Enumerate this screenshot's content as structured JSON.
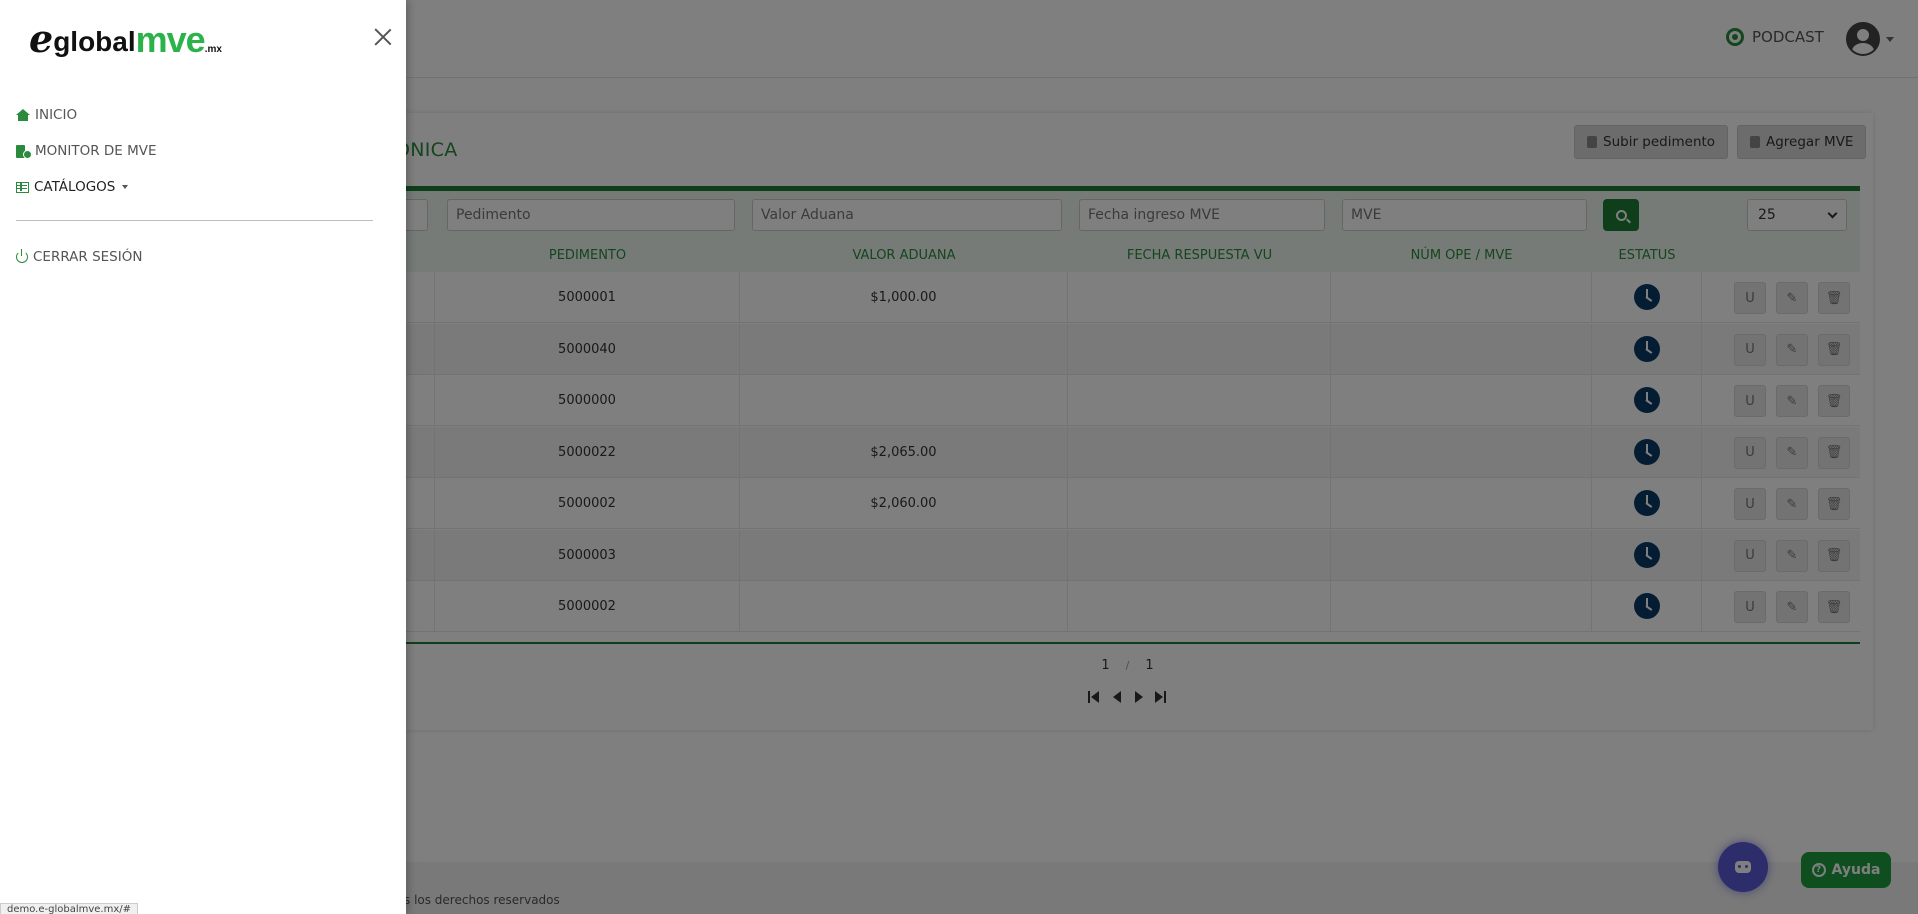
{
  "header": {
    "podcast_label": "PODCAST"
  },
  "card": {
    "title_fragment": "ÓNICA",
    "upload_button": "Subir pedimento",
    "add_button": "Agregar MVE"
  },
  "filters": {
    "pedimento_placeholder": "Pedimento",
    "valor_aduana_placeholder": "Valor Aduana",
    "fecha_ingreso_placeholder": "Fecha ingreso MVE",
    "mve_placeholder": "MVE",
    "page_size": "25"
  },
  "table": {
    "headers": {
      "pedimento": "PEDIMENTO",
      "valor_aduana": "VALOR ADUANA",
      "fecha_respuesta": "FECHA RESPUESTA VU",
      "num_ope": "NÚM OPE / MVE",
      "estatus": "ESTATUS"
    },
    "rows": [
      {
        "pedimento": "5000001",
        "valor_aduana": "$1,000.00"
      },
      {
        "pedimento": "5000040",
        "valor_aduana": ""
      },
      {
        "pedimento": "5000000",
        "valor_aduana": ""
      },
      {
        "pedimento": "5000022",
        "valor_aduana": "$2,065.00"
      },
      {
        "pedimento": "5000002",
        "valor_aduana": "$2,060.00"
      },
      {
        "pedimento": "5000003",
        "valor_aduana": ""
      },
      {
        "pedimento": "5000002",
        "valor_aduana": ""
      }
    ],
    "action_u_label": "U"
  },
  "pager": {
    "current": "1",
    "separator": "/",
    "total": "1"
  },
  "footer": {
    "text": "s los derechos reservados"
  },
  "help": {
    "label": "Ayuda"
  },
  "drawer": {
    "logo": {
      "e": "e",
      "global": "global",
      "mve": "mve",
      "mx": ".mx"
    },
    "items": [
      {
        "label": "INICIO",
        "icon": "home-icon"
      },
      {
        "label": "MONITOR DE MVE",
        "icon": "file-icon"
      },
      {
        "label": "CATÁLOGOS",
        "icon": "table-icon"
      },
      {
        "label": "CERRAR SESIÓN",
        "icon": "power-icon"
      }
    ]
  },
  "status_bar": {
    "url": "demo.e-globalmve.mx/#"
  },
  "colors": {
    "brand_green": "#2b8a3e",
    "dark_green": "#1e7e34",
    "logo_green": "#2bb34b",
    "status_navy": "#0b3a66",
    "bot_purple": "#5b5bd6"
  }
}
